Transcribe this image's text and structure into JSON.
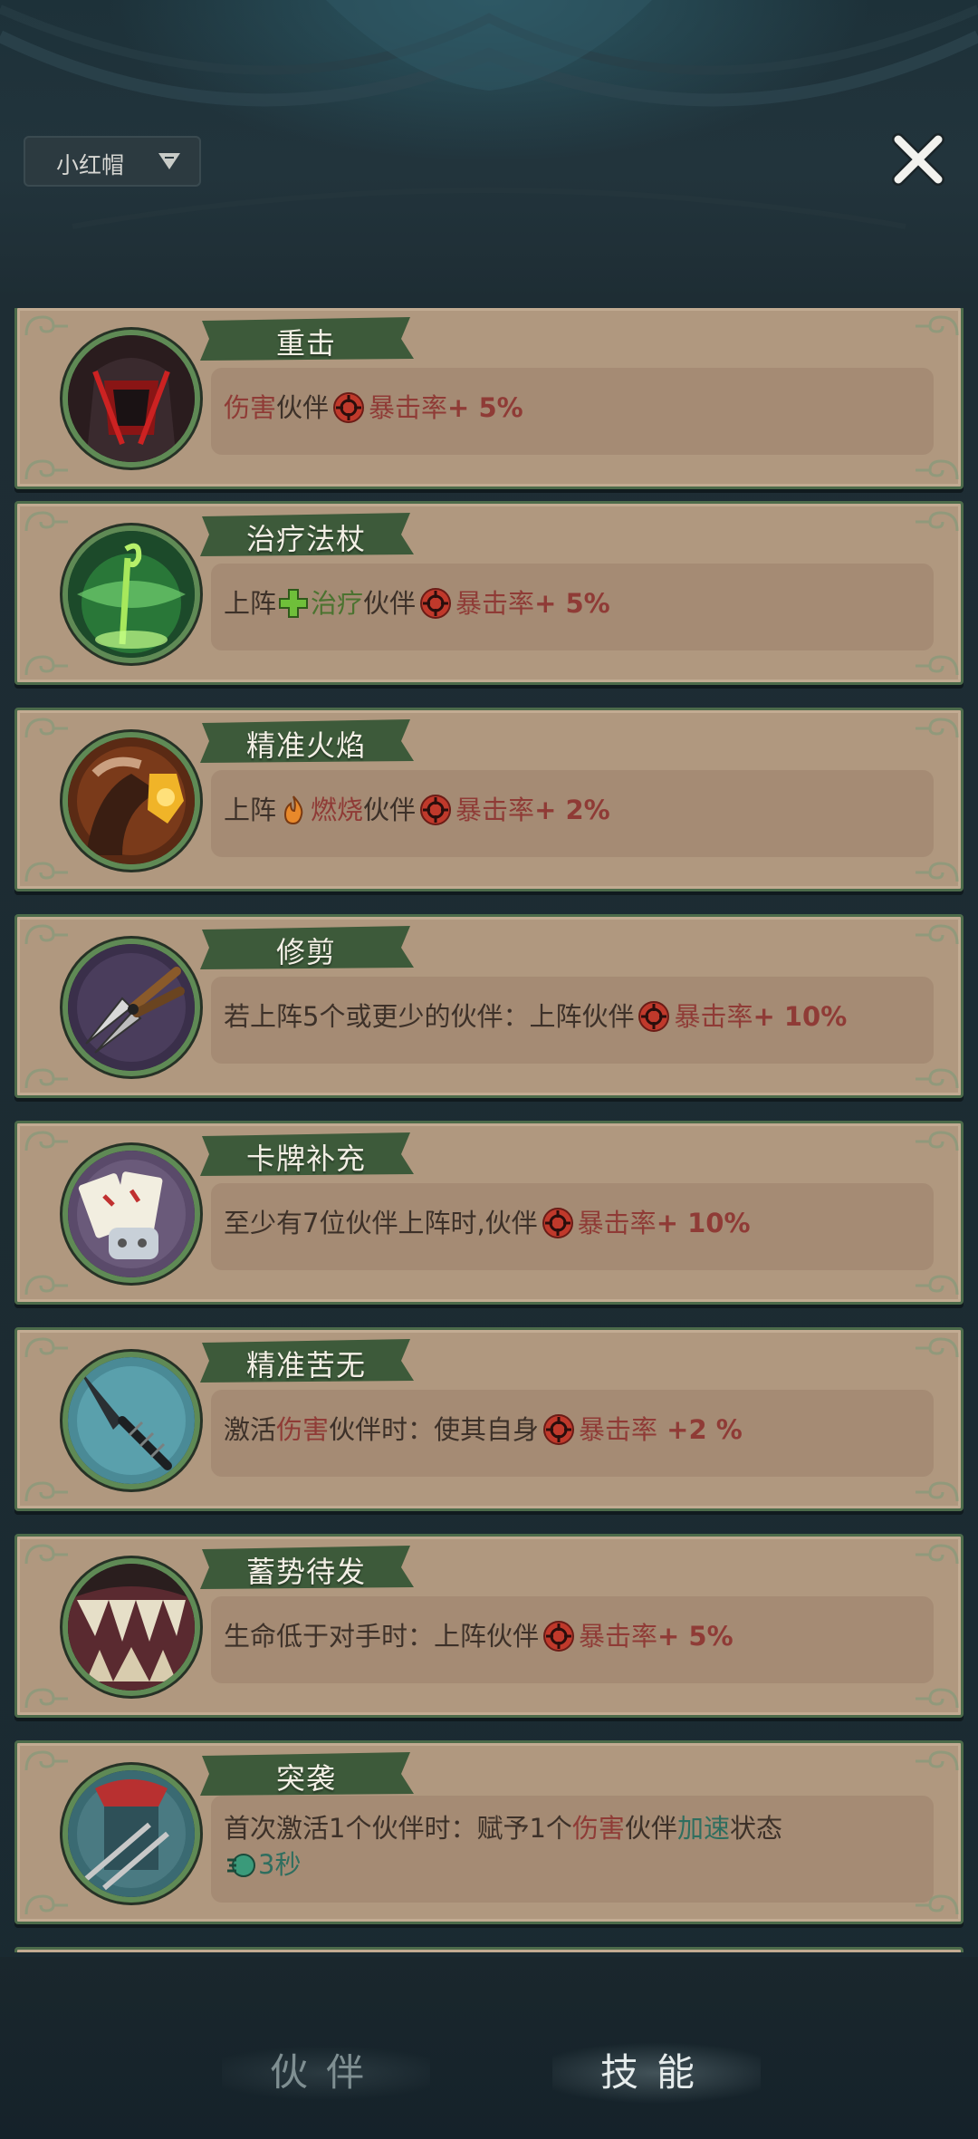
{
  "header": {
    "character_select": "小红帽",
    "close_icon": "close-x-icon"
  },
  "colors": {
    "card_bg": "#b0987f",
    "card_border": "#4c6b4a",
    "banner_green": "#3d5a3a",
    "keyword_red": "#8f3b36",
    "keyword_green": "#4b7330",
    "keyword_teal": "#2f6e5f"
  },
  "cards": [
    {
      "title": "重击",
      "icon": "dark-armor-icon",
      "desc": {
        "t1": "伤害",
        "t2": "伙伴",
        "stat": "暴击率",
        "value": "+ 5%"
      }
    },
    {
      "title": "治疗法杖",
      "icon": "green-staff-icon",
      "desc": {
        "t0": "上阵",
        "t1": "治疗",
        "t2": "伙伴",
        "stat": "暴击率",
        "value": "+ 5%"
      }
    },
    {
      "title": "精准火焰",
      "icon": "fire-gauntlet-icon",
      "desc": {
        "t0": "上阵",
        "t1": "燃烧",
        "t2": "伙伴",
        "stat": "暴击率",
        "value": "+ 2%"
      }
    },
    {
      "title": "修剪",
      "icon": "pruning-shears-icon",
      "desc": {
        "t0": "若上阵5个或更少的伙伴：上阵伙伴",
        "stat": "暴击率",
        "value": "+ 10%"
      }
    },
    {
      "title": "卡牌补充",
      "icon": "playing-cards-icon",
      "desc": {
        "t0": "至少有7位伙伴上阵时,伙伴",
        "stat": "暴击率",
        "value": "+ 10%"
      }
    },
    {
      "title": "精准苦无",
      "icon": "kunai-icon",
      "desc": {
        "t0": "激活",
        "t1": "伤害",
        "t2": "伙伴时：使其自身",
        "stat": "暴击率",
        "value": " +2 %"
      }
    },
    {
      "title": "蓄势待发",
      "icon": "fanged-mouth-icon",
      "desc": {
        "t0": "生命低于对手时：上阵伙伴",
        "stat": "暴击率",
        "value": "+ 5%"
      }
    },
    {
      "title": "突袭",
      "icon": "ambush-creature-icon",
      "desc": {
        "t0": "首次激活1个伙伴时：赋予1个",
        "t1": "伤害",
        "t2": "伙伴",
        "t3": "加速",
        "t4": "状态",
        "dur": "3秒"
      }
    }
  ],
  "tabs": {
    "partner": "伙伴",
    "skill": "技能"
  }
}
